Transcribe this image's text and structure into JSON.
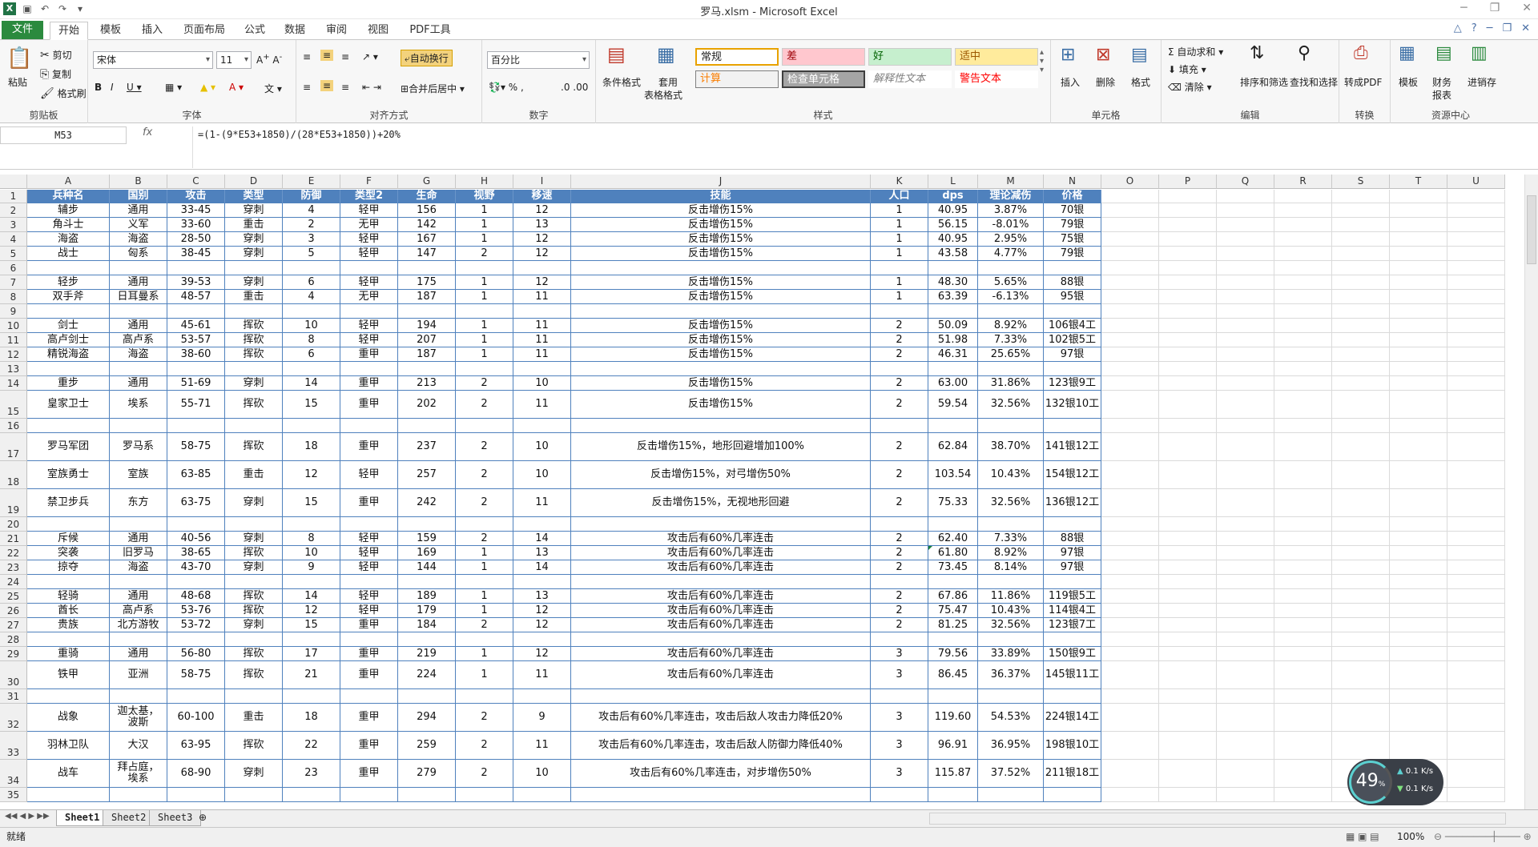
{
  "window": {
    "title": "罗马.xlsm - Microsoft Excel"
  },
  "tabs": [
    "文件",
    "开始",
    "模板",
    "插入",
    "页面布局",
    "公式",
    "数据",
    "审阅",
    "视图",
    "PDF工具"
  ],
  "ribbon": {
    "clipboard": {
      "label": "剪贴板",
      "paste": "粘贴",
      "cut": "剪切",
      "copy": "复制",
      "painter": "格式刷"
    },
    "font": {
      "label": "字体",
      "family": "宋体",
      "size": "11"
    },
    "align": {
      "label": "对齐方式",
      "wrap": "自动换行",
      "merge": "合并后居中"
    },
    "number": {
      "label": "数字",
      "format": "百分比"
    },
    "styles": {
      "label": "样式",
      "cond": "条件格式",
      "table1": "套用",
      "table2": "表格格式",
      "normal": "常规",
      "bad": "差",
      "good": "好",
      "neutral": "适中",
      "calc": "计算",
      "check": "检查单元格",
      "explain": "解释性文本",
      "warn": "警告文本"
    },
    "cells": {
      "label": "单元格",
      "insert": "插入",
      "delete": "删除",
      "format": "格式"
    },
    "edit": {
      "label": "编辑",
      "autosum": "自动求和",
      "fill": "填充",
      "clear": "清除",
      "sort": "排序和筛选",
      "find": "查找和选择"
    },
    "convert": {
      "label": "转换",
      "pdf": "转成PDF"
    },
    "resource": {
      "label": "资源中心",
      "template": "模板",
      "finance1": "财务",
      "finance2": "报表",
      "sale": "进销存"
    }
  },
  "formula_bar": {
    "namebox": "M53",
    "fx": "fx",
    "formula": "=(1-(9*E53+1850)/(28*E53+1850))+20%"
  },
  "columns": [
    "A",
    "B",
    "C",
    "D",
    "E",
    "F",
    "G",
    "H",
    "I",
    "J",
    "K",
    "L",
    "M",
    "N",
    "O",
    "P",
    "Q",
    "R",
    "S",
    "T",
    "U"
  ],
  "rows": [
    {
      "n": "1",
      "c": [
        "兵种名",
        "国别",
        "攻击",
        "类型",
        "防御",
        "类型2",
        "生命",
        "视野",
        "移速",
        "技能",
        "人口",
        "dps",
        "理论减伤",
        "价格"
      ]
    },
    {
      "n": "2",
      "c": [
        "辅步",
        "通用",
        "33-45",
        "穿刺",
        "4",
        "轻甲",
        "156",
        "1",
        "12",
        "反击增伤15%",
        "1",
        "40.95",
        "3.87%",
        "70银"
      ]
    },
    {
      "n": "3",
      "c": [
        "角斗士",
        "义军",
        "33-60",
        "重击",
        "2",
        "无甲",
        "142",
        "1",
        "13",
        "反击增伤15%",
        "1",
        "56.15",
        "-8.01%",
        "79银"
      ]
    },
    {
      "n": "4",
      "c": [
        "海盗",
        "海盗",
        "28-50",
        "穿刺",
        "3",
        "轻甲",
        "167",
        "1",
        "12",
        "反击增伤15%",
        "1",
        "40.95",
        "2.95%",
        "75银"
      ]
    },
    {
      "n": "5",
      "c": [
        "战士",
        "匈系",
        "38-45",
        "穿刺",
        "5",
        "轻甲",
        "147",
        "2",
        "12",
        "反击增伤15%",
        "1",
        "43.58",
        "4.77%",
        "79银"
      ]
    },
    {
      "n": "6",
      "c": []
    },
    {
      "n": "7",
      "c": [
        "轻步",
        "通用",
        "39-53",
        "穿刺",
        "6",
        "轻甲",
        "175",
        "1",
        "12",
        "反击增伤15%",
        "1",
        "48.30",
        "5.65%",
        "88银"
      ]
    },
    {
      "n": "8",
      "c": [
        "双手斧",
        "日耳曼系",
        "48-57",
        "重击",
        "4",
        "无甲",
        "187",
        "1",
        "11",
        "反击增伤15%",
        "1",
        "63.39",
        "-6.13%",
        "95银"
      ]
    },
    {
      "n": "9",
      "c": []
    },
    {
      "n": "10",
      "c": [
        "剑士",
        "通用",
        "45-61",
        "挥砍",
        "10",
        "轻甲",
        "194",
        "1",
        "11",
        "反击增伤15%",
        "2",
        "50.09",
        "8.92%",
        "106银4工"
      ]
    },
    {
      "n": "11",
      "c": [
        "高卢剑士",
        "高卢系",
        "53-57",
        "挥砍",
        "8",
        "轻甲",
        "207",
        "1",
        "11",
        "反击增伤15%",
        "2",
        "51.98",
        "7.33%",
        "102银5工"
      ]
    },
    {
      "n": "12",
      "c": [
        "精锐海盗",
        "海盗",
        "38-60",
        "挥砍",
        "6",
        "重甲",
        "187",
        "1",
        "11",
        "反击增伤15%",
        "2",
        "46.31",
        "25.65%",
        "97银"
      ]
    },
    {
      "n": "13",
      "c": []
    },
    {
      "n": "14",
      "c": [
        "重步",
        "通用",
        "51-69",
        "穿刺",
        "14",
        "重甲",
        "213",
        "2",
        "10",
        "反击增伤15%",
        "2",
        "63.00",
        "31.86%",
        "123银9工"
      ]
    },
    {
      "n": "15",
      "c": [
        "皇家卫士",
        "埃系",
        "55-71",
        "挥砍",
        "15",
        "重甲",
        "202",
        "2",
        "11",
        "反击增伤15%",
        "2",
        "59.54",
        "32.56%",
        "132银10工"
      ]
    },
    {
      "n": "16",
      "c": []
    },
    {
      "n": "17",
      "c": [
        "罗马军团",
        "罗马系",
        "58-75",
        "挥砍",
        "18",
        "重甲",
        "237",
        "2",
        "10",
        "反击增伤15%，地形回避增加100%",
        "2",
        "62.84",
        "38.70%",
        "141银12工"
      ]
    },
    {
      "n": "18",
      "c": [
        "室族勇士",
        "室族",
        "63-85",
        "重击",
        "12",
        "轻甲",
        "257",
        "2",
        "10",
        "反击增伤15%，对弓增伤50%",
        "2",
        "103.54",
        "10.43%",
        "154银12工"
      ]
    },
    {
      "n": "19",
      "c": [
        "禁卫步兵",
        "东方",
        "63-75",
        "穿刺",
        "15",
        "重甲",
        "242",
        "2",
        "11",
        "反击增伤15%，无视地形回避",
        "2",
        "75.33",
        "32.56%",
        "136银12工"
      ]
    },
    {
      "n": "20",
      "c": []
    },
    {
      "n": "21",
      "c": [
        "斥候",
        "通用",
        "40-56",
        "穿刺",
        "8",
        "轻甲",
        "159",
        "2",
        "14",
        "攻击后有60%几率连击",
        "2",
        "62.40",
        "7.33%",
        "88银"
      ]
    },
    {
      "n": "22",
      "c": [
        "突袭",
        "旧罗马",
        "38-65",
        "挥砍",
        "10",
        "轻甲",
        "169",
        "1",
        "13",
        "攻击后有60%几率连击",
        "2",
        "61.80",
        "8.92%",
        "97银"
      ]
    },
    {
      "n": "23",
      "c": [
        "掠夺",
        "海盗",
        "43-70",
        "穿刺",
        "9",
        "轻甲",
        "144",
        "1",
        "14",
        "攻击后有60%几率连击",
        "2",
        "73.45",
        "8.14%",
        "97银"
      ]
    },
    {
      "n": "24",
      "c": []
    },
    {
      "n": "25",
      "c": [
        "轻骑",
        "通用",
        "48-68",
        "挥砍",
        "14",
        "轻甲",
        "189",
        "1",
        "13",
        "攻击后有60%几率连击",
        "2",
        "67.86",
        "11.86%",
        "119银5工"
      ]
    },
    {
      "n": "26",
      "c": [
        "酋长",
        "高卢系",
        "53-76",
        "挥砍",
        "12",
        "轻甲",
        "179",
        "1",
        "12",
        "攻击后有60%几率连击",
        "2",
        "75.47",
        "10.43%",
        "114银4工"
      ]
    },
    {
      "n": "27",
      "c": [
        "贵族",
        "北方游牧",
        "53-72",
        "穿刺",
        "15",
        "重甲",
        "184",
        "2",
        "12",
        "攻击后有60%几率连击",
        "2",
        "81.25",
        "32.56%",
        "123银7工"
      ]
    },
    {
      "n": "28",
      "c": []
    },
    {
      "n": "29",
      "c": [
        "重骑",
        "通用",
        "56-80",
        "挥砍",
        "17",
        "重甲",
        "219",
        "1",
        "12",
        "攻击后有60%几率连击",
        "3",
        "79.56",
        "33.89%",
        "150银9工"
      ]
    },
    {
      "n": "30",
      "c": [
        "铁甲",
        "亚洲",
        "58-75",
        "挥砍",
        "21",
        "重甲",
        "224",
        "1",
        "11",
        "攻击后有60%几率连击",
        "3",
        "86.45",
        "36.37%",
        "145银11工"
      ]
    },
    {
      "n": "31",
      "c": []
    },
    {
      "n": "32",
      "c": [
        "战象",
        "迦太基，波斯",
        "60-100",
        "重击",
        "18",
        "重甲",
        "294",
        "2",
        "9",
        "攻击后有60%几率连击，攻击后敌人攻击力降低20%",
        "3",
        "119.60",
        "54.53%",
        "224银14工"
      ]
    },
    {
      "n": "33",
      "c": [
        "羽林卫队",
        "大汉",
        "63-95",
        "挥砍",
        "22",
        "重甲",
        "259",
        "2",
        "11",
        "攻击后有60%几率连击，攻击后敌人防御力降低40%",
        "3",
        "96.91",
        "36.95%",
        "198银10工"
      ]
    },
    {
      "n": "34",
      "c": [
        "战车",
        "拜占庭，埃系",
        "68-90",
        "穿刺",
        "23",
        "重甲",
        "279",
        "2",
        "10",
        "攻击后有60%几率连击，对步增伤50%",
        "3",
        "115.87",
        "37.52%",
        "211银18工"
      ]
    },
    {
      "n": "35",
      "c": []
    }
  ],
  "sheets": [
    "Sheet1",
    "Sheet2",
    "Sheet3"
  ],
  "status": {
    "ready": "就绪",
    "zoom": "100%"
  },
  "speed_widget": {
    "percent": "49",
    "unit": "%",
    "up": "0.1",
    "down": "0.1",
    "rate_unit": "K/s"
  },
  "colors": {
    "header_fill": "#4f81bd",
    "file_tab": "#2b8a3e"
  }
}
